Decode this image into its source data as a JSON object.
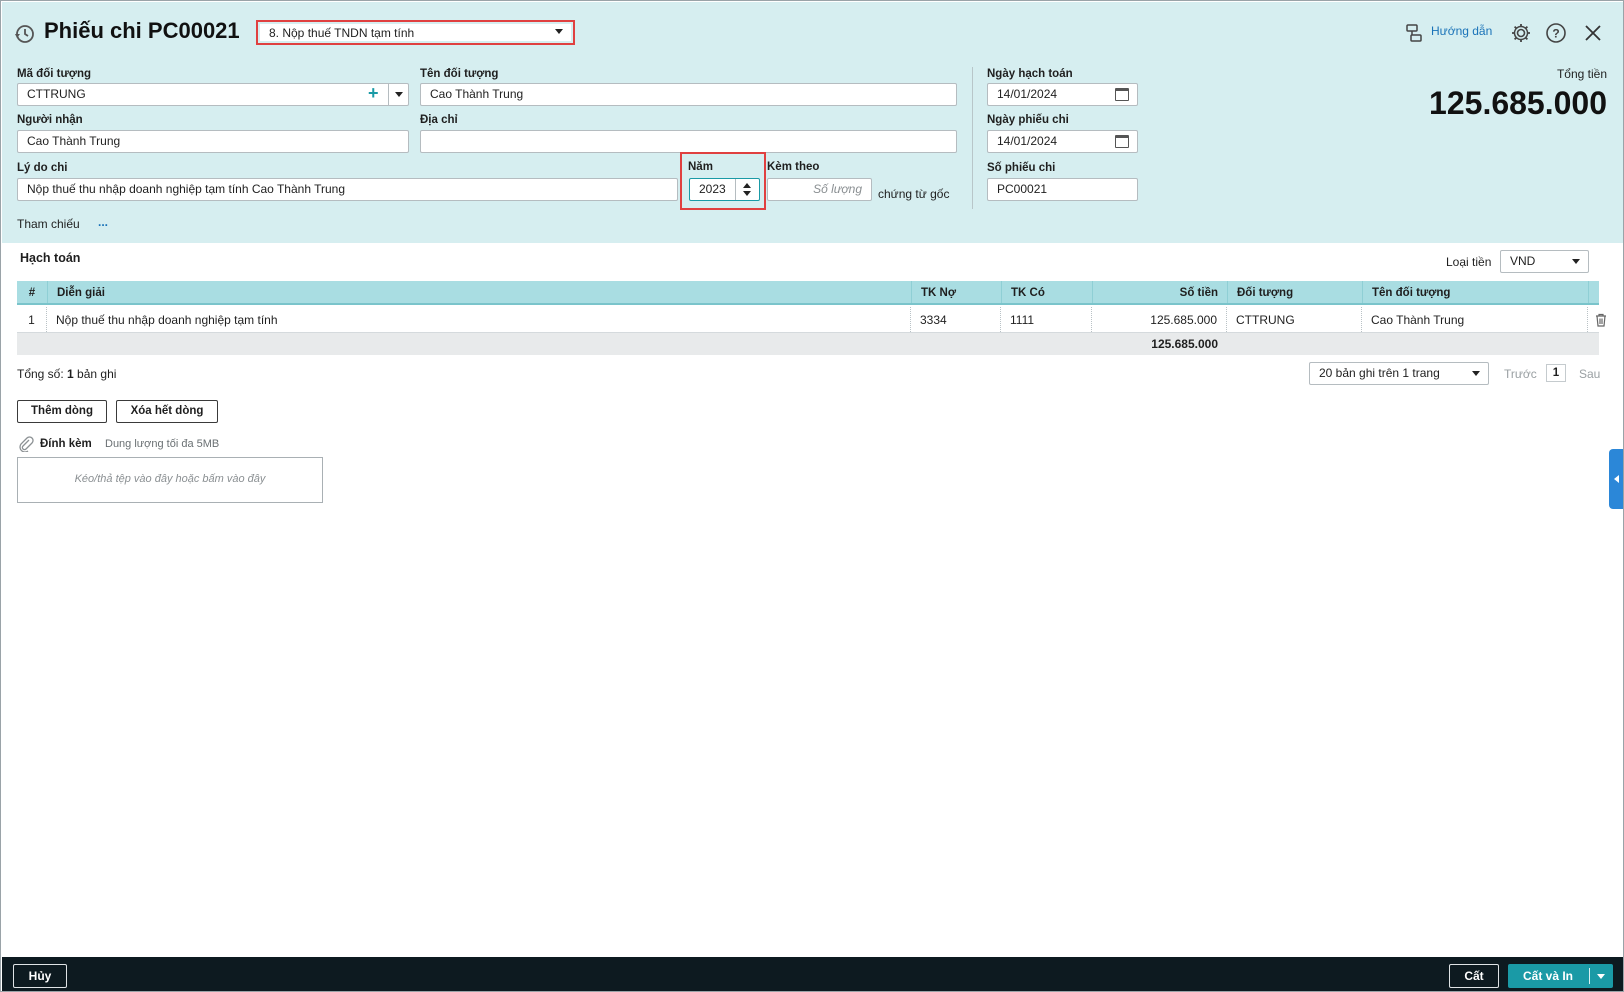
{
  "header": {
    "title": "Phiếu chi PC00021",
    "voucher_type": "8. Nộp thuế TNDN tạm tính",
    "guide_label": "Hướng dẫn",
    "total_label": "Tổng tiền",
    "total_value": "125.685.000"
  },
  "form": {
    "ma_doi_tuong_label": "Mã đối tượng",
    "ma_doi_tuong_value": "CTTRUNG",
    "ten_doi_tuong_label": "Tên đối tượng",
    "ten_doi_tuong_value": "Cao Thành Trung",
    "nguoi_nhan_label": "Người nhận",
    "nguoi_nhan_value": "Cao Thành Trung",
    "dia_chi_label": "Địa chỉ",
    "dia_chi_value": "",
    "ly_do_chi_label": "Lý do chi",
    "ly_do_chi_value": "Nộp thuế thu nhập doanh nghiệp tạm tính Cao Thành Trung",
    "nam_label": "Năm",
    "nam_value": "2023",
    "kem_theo_label": "Kèm theo",
    "so_luong_placeholder": "Số lượng",
    "chung_tu_goc": "chứng từ gốc",
    "tham_chieu_label": "Tham chiếu",
    "tham_chieu_more": "...",
    "ngay_hach_toan_label": "Ngày hạch toán",
    "ngay_hach_toan_value": "14/01/2024",
    "ngay_phieu_chi_label": "Ngày phiếu chi",
    "ngay_phieu_chi_value": "14/01/2024",
    "so_phieu_chi_label": "Số phiếu chi",
    "so_phieu_chi_value": "PC00021"
  },
  "accounting": {
    "section_title": "Hạch toán",
    "currency_label": "Loại tiền",
    "currency_value": "VND",
    "columns": [
      "#",
      "Diễn giải",
      "TK Nợ",
      "TK Có",
      "Số tiền",
      "Đối tượng",
      "Tên đối tượng"
    ],
    "rows": [
      {
        "no": "1",
        "dien_giai": "Nộp thuế thu nhập doanh nghiệp tạm tính",
        "tk_no": "3334",
        "tk_co": "1111",
        "so_tien": "125.685.000",
        "doi_tuong": "CTTRUNG",
        "ten_doi_tuong": "Cao Thành Trung"
      }
    ],
    "sum_value": "125.685.000",
    "total_records_prefix": "Tổng số: ",
    "total_records_count": "1",
    "total_records_suffix": " bản ghi",
    "page_size": "20 bản ghi trên 1 trang",
    "prev": "Trước",
    "page": "1",
    "next": "Sau",
    "add_row": "Thêm dòng",
    "clear_rows": "Xóa hết dòng"
  },
  "attachment": {
    "label": "Đính kèm",
    "limit": "Dung lượng tối đa 5MB",
    "dropzone": "Kéo/thả tệp vào đây hoặc bấm vào đây"
  },
  "footer": {
    "cancel": "Hủy",
    "save": "Cất",
    "save_print": "Cất và In"
  },
  "colors": {
    "header_bg": "#d6eef0",
    "accent": "#1a9aa6",
    "grid_head": "#a9dde2",
    "highlight": "#e04040",
    "footer_bg": "#0d1a20"
  }
}
